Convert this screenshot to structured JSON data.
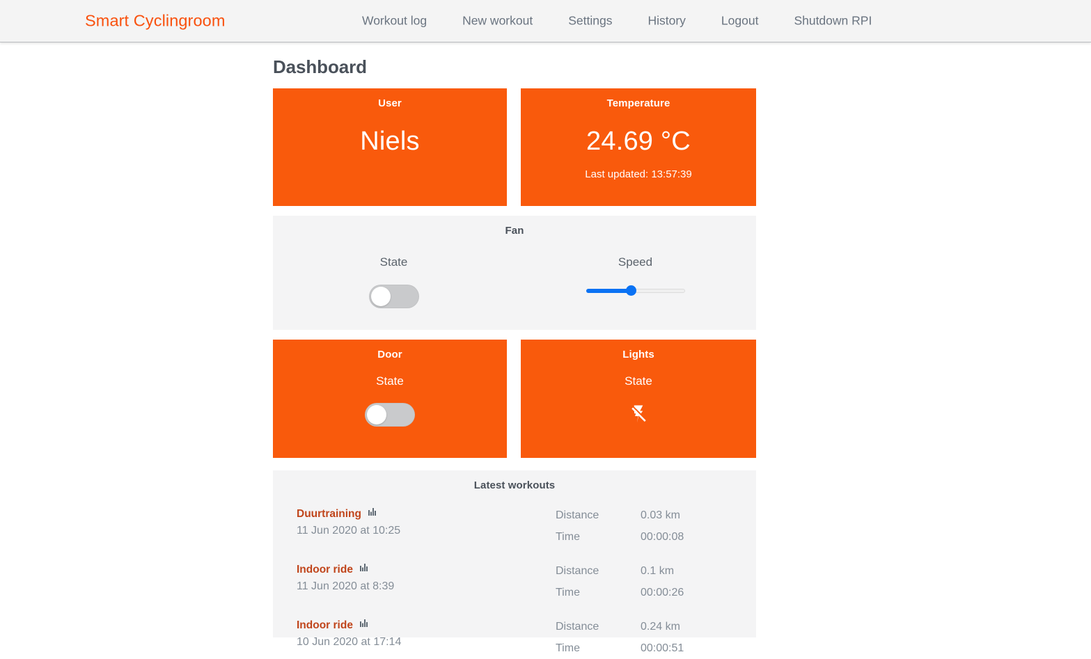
{
  "navbar": {
    "brand": "Smart Cyclingroom",
    "links": [
      {
        "label": "Workout log"
      },
      {
        "label": "New workout"
      },
      {
        "label": "Settings"
      },
      {
        "label": "History"
      },
      {
        "label": "Logout"
      },
      {
        "label": "Shutdown RPI"
      }
    ]
  },
  "page": {
    "title": "Dashboard"
  },
  "colors": {
    "accent": "#f95a0c",
    "brand_text": "#f9510e",
    "panel_bg": "#f4f4f5",
    "navbar_bg": "#f4f4f4",
    "slider_blue": "#0a72f4",
    "toggle_off": "#c9cacc",
    "workout_link": "#c0451b",
    "heading": "#4a515a",
    "muted_text": "#848d97"
  },
  "user_card": {
    "title": "User",
    "value": "Niels"
  },
  "temperature_card": {
    "title": "Temperature",
    "value": "24.69 °C",
    "last_updated": "Last updated: 13:57:39"
  },
  "fan_card": {
    "title": "Fan",
    "state_label": "State",
    "state_value": "off",
    "state_icon": "toggle-off-icon",
    "speed_label": "Speed",
    "speed_percent": 46
  },
  "door_card": {
    "title": "Door",
    "state_label": "State",
    "state_value": "off",
    "state_icon": "toggle-off-icon"
  },
  "lights_card": {
    "title": "Lights",
    "state_label": "State",
    "state_value": "off",
    "state_icon": "flash-off-icon"
  },
  "latest_workouts": {
    "title": "Latest workouts",
    "metric_labels": {
      "distance": "Distance",
      "time": "Time"
    },
    "chart_icon": "bar-chart-icon",
    "rows": [
      {
        "name": "Duurtraining",
        "date": "11 Jun 2020 at 10:25",
        "distance_label": "Distance",
        "distance": "0.03 km",
        "time_label": "Time",
        "time": "00:00:08"
      },
      {
        "name": "Indoor ride",
        "date": "11 Jun 2020 at 8:39",
        "distance_label": "Distance",
        "distance": "0.1 km",
        "time_label": "Time",
        "time": "00:00:26"
      },
      {
        "name": "Indoor ride",
        "date": "10 Jun 2020 at 17:14",
        "distance_label": "Distance",
        "distance": "0.24 km",
        "time_label": "Time",
        "time": "00:00:51"
      }
    ]
  }
}
